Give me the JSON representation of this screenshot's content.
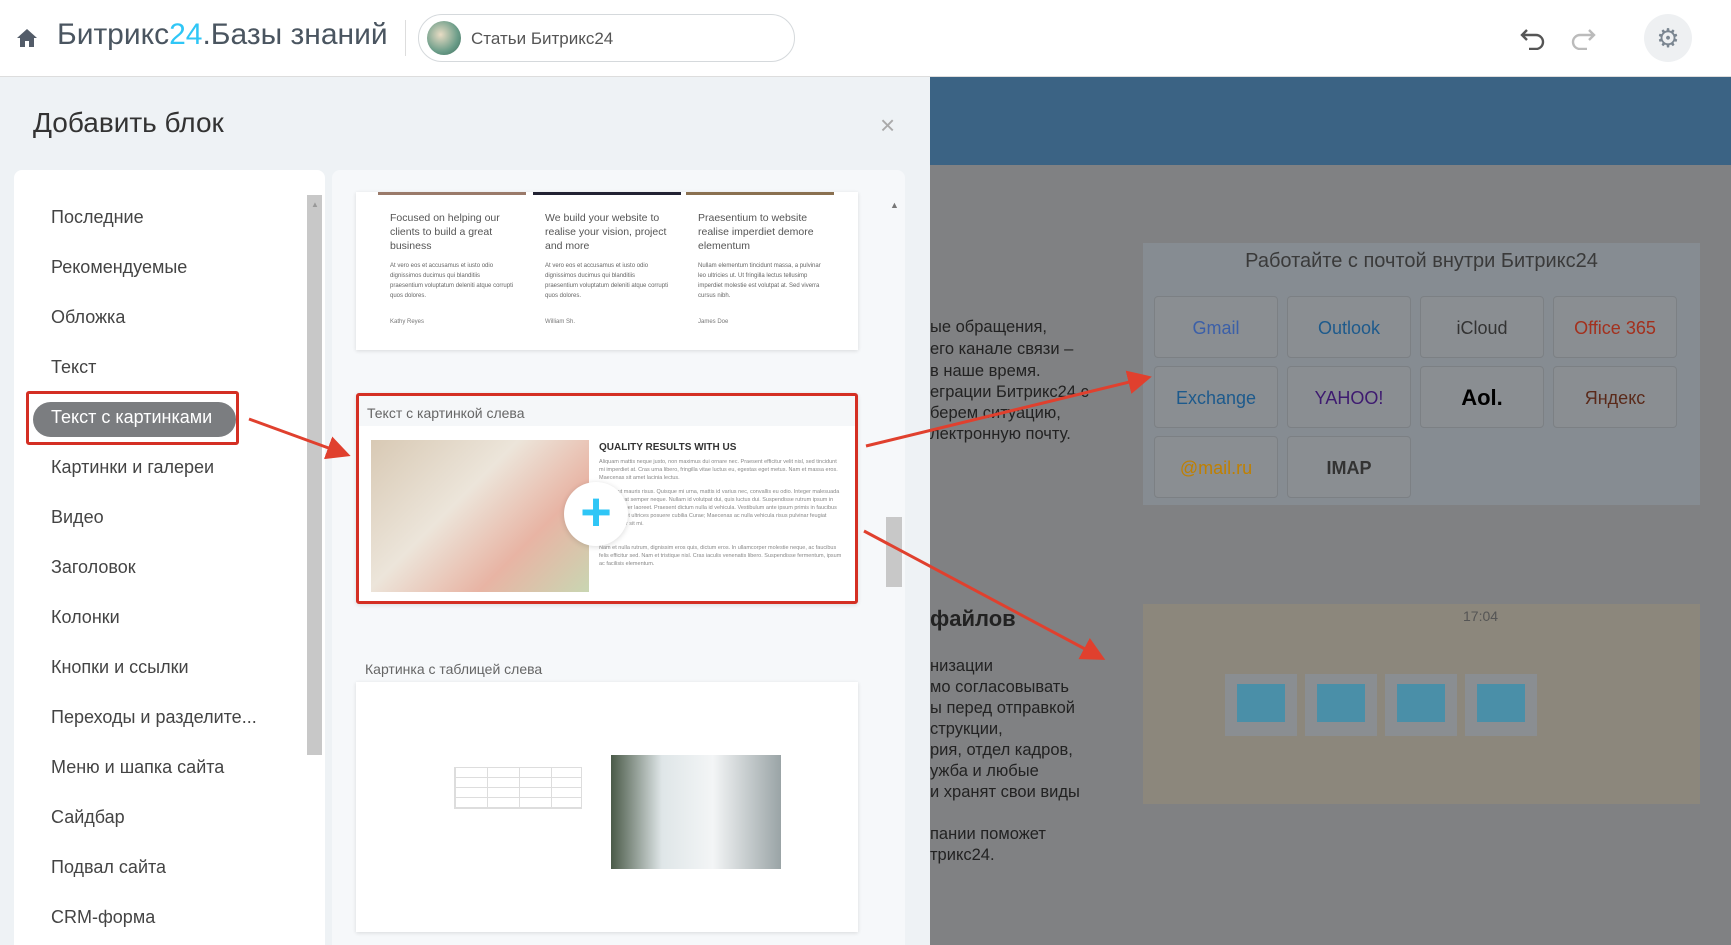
{
  "header": {
    "title_prefix": "Битрикс",
    "title_num": "24",
    "title_suffix": ".Базы знаний",
    "site_selector": "Статьи Битрикс24",
    "icons": [
      "home-icon",
      "undo-icon",
      "redo-icon",
      "gear-icon"
    ]
  },
  "panel": {
    "title": "Добавить блок",
    "close": "×",
    "categories": [
      "Последние",
      "Рекомендуемые",
      "Обложка",
      "Текст",
      "Текст с картинками",
      "Картинки и галереи",
      "Видео",
      "Заголовок",
      "Колонки",
      "Кнопки и ссылки",
      "Переходы и разделите...",
      "Меню и шапка сайта",
      "Сайдбар",
      "Подвал сайта",
      "CRM-форма"
    ],
    "selected_category": "Текст с картинками",
    "blocks": [
      {
        "columns": [
          {
            "heading": "Focused on helping our clients to build a great business",
            "text": "At vero eos et accusamus et iusto odio dignissimos ducimus qui blanditiis praesentium voluptatum deleniti atque corrupti quos dolores.",
            "author": "Kathy Reyes"
          },
          {
            "heading": "We build your website to realise your vision, project and more",
            "text": "At vero eos et accusamus et iusto odio dignissimos ducimus qui blanditiis praesentium voluptatum deleniti atque corrupti quos dolores.",
            "author": "William Sh."
          },
          {
            "heading": "Praesentium to website realise imperdiet demore elementum",
            "text": "Nullam elementum tincidunt massa, a pulvinar leo ultricies ut. Ut fringilla lectus tellusimp imperdiet molestie est volutpat at. Sed viverra cursus nibh.",
            "author": "James Doe"
          }
        ]
      },
      {
        "label": "Текст с картинкой слева",
        "heading": "QUALITY RESULTS WITH US",
        "paragraphs": [
          "Aliquam mattis neque justo, non maximus dui ornare nec. Praesent efficitur velit nisl, sed tincidunt mi imperdiet at. Cras urna libero, fringilla vitae luctus eu, egestas eget metus. Nam et massa eros. Maecenas sit amet lacinia lectus.",
          "Nullam ut mauris risus. Quisque mi urna, mattis id varius nec, convallis eu odio. Integer malesuada leo, placerat semper neque. Nullam id volutpat dui, quis luctus dui. Suspendisse rutrum ipsum in quam semper laoreet. Praesent dictum nulla id vehicula. Vestibulum ante ipsum primis in faucibus orci luctus et ultrices posuere cubilia Curae; Maecenas ac nulla vehicula risus pulvinar feugiat ullamcorper sit mi.",
          "Nam et nulla rutrum, dignissim eros quis, dictum eros. In ullamcorper molestie neque, ac faucibus felis efficitur sed. Nam et tristique nisl. Cras iaculis venenatis libero. Suspendisse fermentum, ipsum ac facilisis elementum."
        ],
        "add_icon": "plus-icon"
      },
      {
        "label": "Картинка с таблицей слева"
      }
    ]
  },
  "background_page": {
    "text_lines": [
      "ые обращения,",
      "его канале связи –",
      "в наше время.",
      "еграции Битрикс24 с",
      "берем ситуацию,",
      "лектронную почту."
    ],
    "section_heading": "файлов",
    "text_lines2": [
      "низации",
      "мо согласовывать",
      "ы перед отправкой",
      "струкции,",
      "рия, отдел кадров,",
      "ужба и любые",
      "и хранят свои виды",
      "",
      "пании поможет",
      "трикс24."
    ],
    "mail_title": "Работайте с почтой внутри Битрикс24",
    "mail_services": [
      "Gmail",
      "Outlook",
      "iCloud",
      "Office 365",
      "Exchange",
      "YAHOO!",
      "Aol.",
      "Яндекс",
      "@mail.ru",
      "IMAP"
    ],
    "drive_time": "17:04"
  },
  "colors": {
    "accent": "#2fc6f6",
    "highlight": "#d42f23",
    "selected": "#7b7d80"
  }
}
